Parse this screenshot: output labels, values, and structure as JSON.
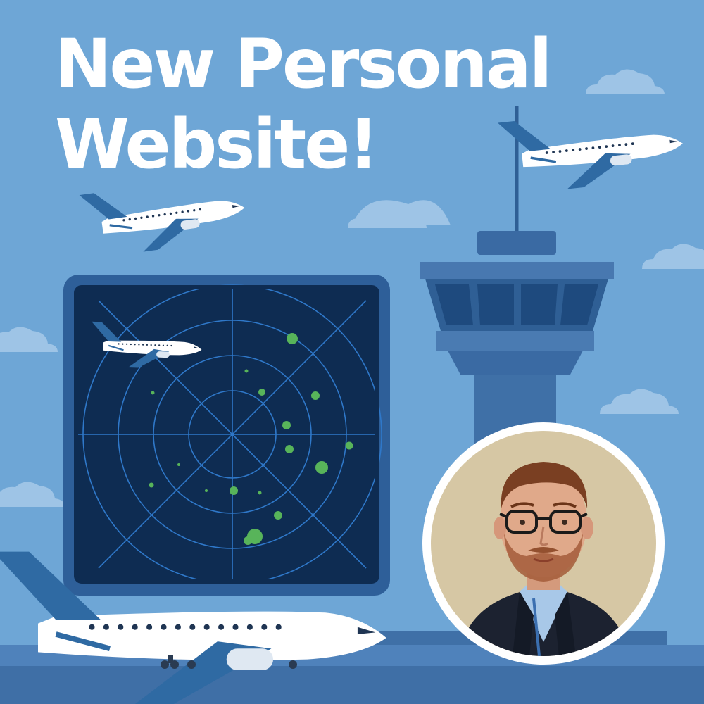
{
  "headline": {
    "line1": "New Personal",
    "line2": "Website!"
  },
  "colors": {
    "sky": "#6ea6d6",
    "radar_screen": "#0e2c52",
    "radar_blip": "#58b45a",
    "tower": "#3f70a7",
    "headline_text": "#ffffff"
  },
  "icons": {
    "planes": "airplane-icon",
    "tower": "control-tower-icon",
    "radar": "radar-icon"
  },
  "profile_photo": {
    "subject": "man with glasses, beard, dark blazer and light blue shirt"
  }
}
